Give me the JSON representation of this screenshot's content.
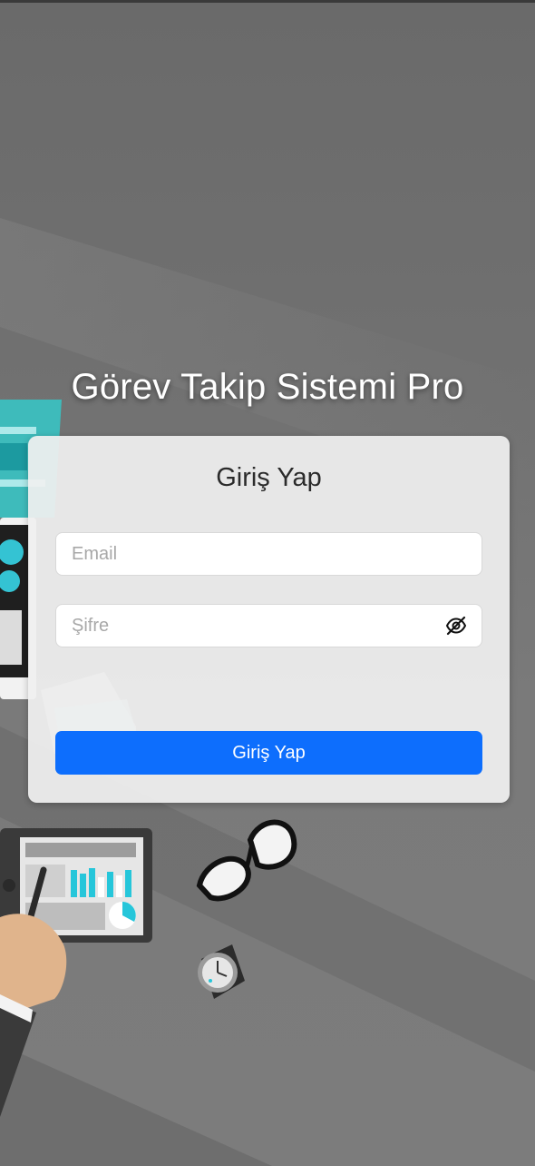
{
  "app": {
    "title": "Görev Takip Sistemi Pro"
  },
  "login": {
    "heading": "Giriş Yap",
    "email": {
      "placeholder": "Email",
      "value": ""
    },
    "password": {
      "placeholder": "Şifre",
      "value": "",
      "toggle_icon": "eye-slash-icon"
    },
    "submit_label": "Giriş Yap"
  },
  "colors": {
    "primary_button": "#0d6efd",
    "accent_teal": "#2ec4c6",
    "background": "#707070"
  }
}
